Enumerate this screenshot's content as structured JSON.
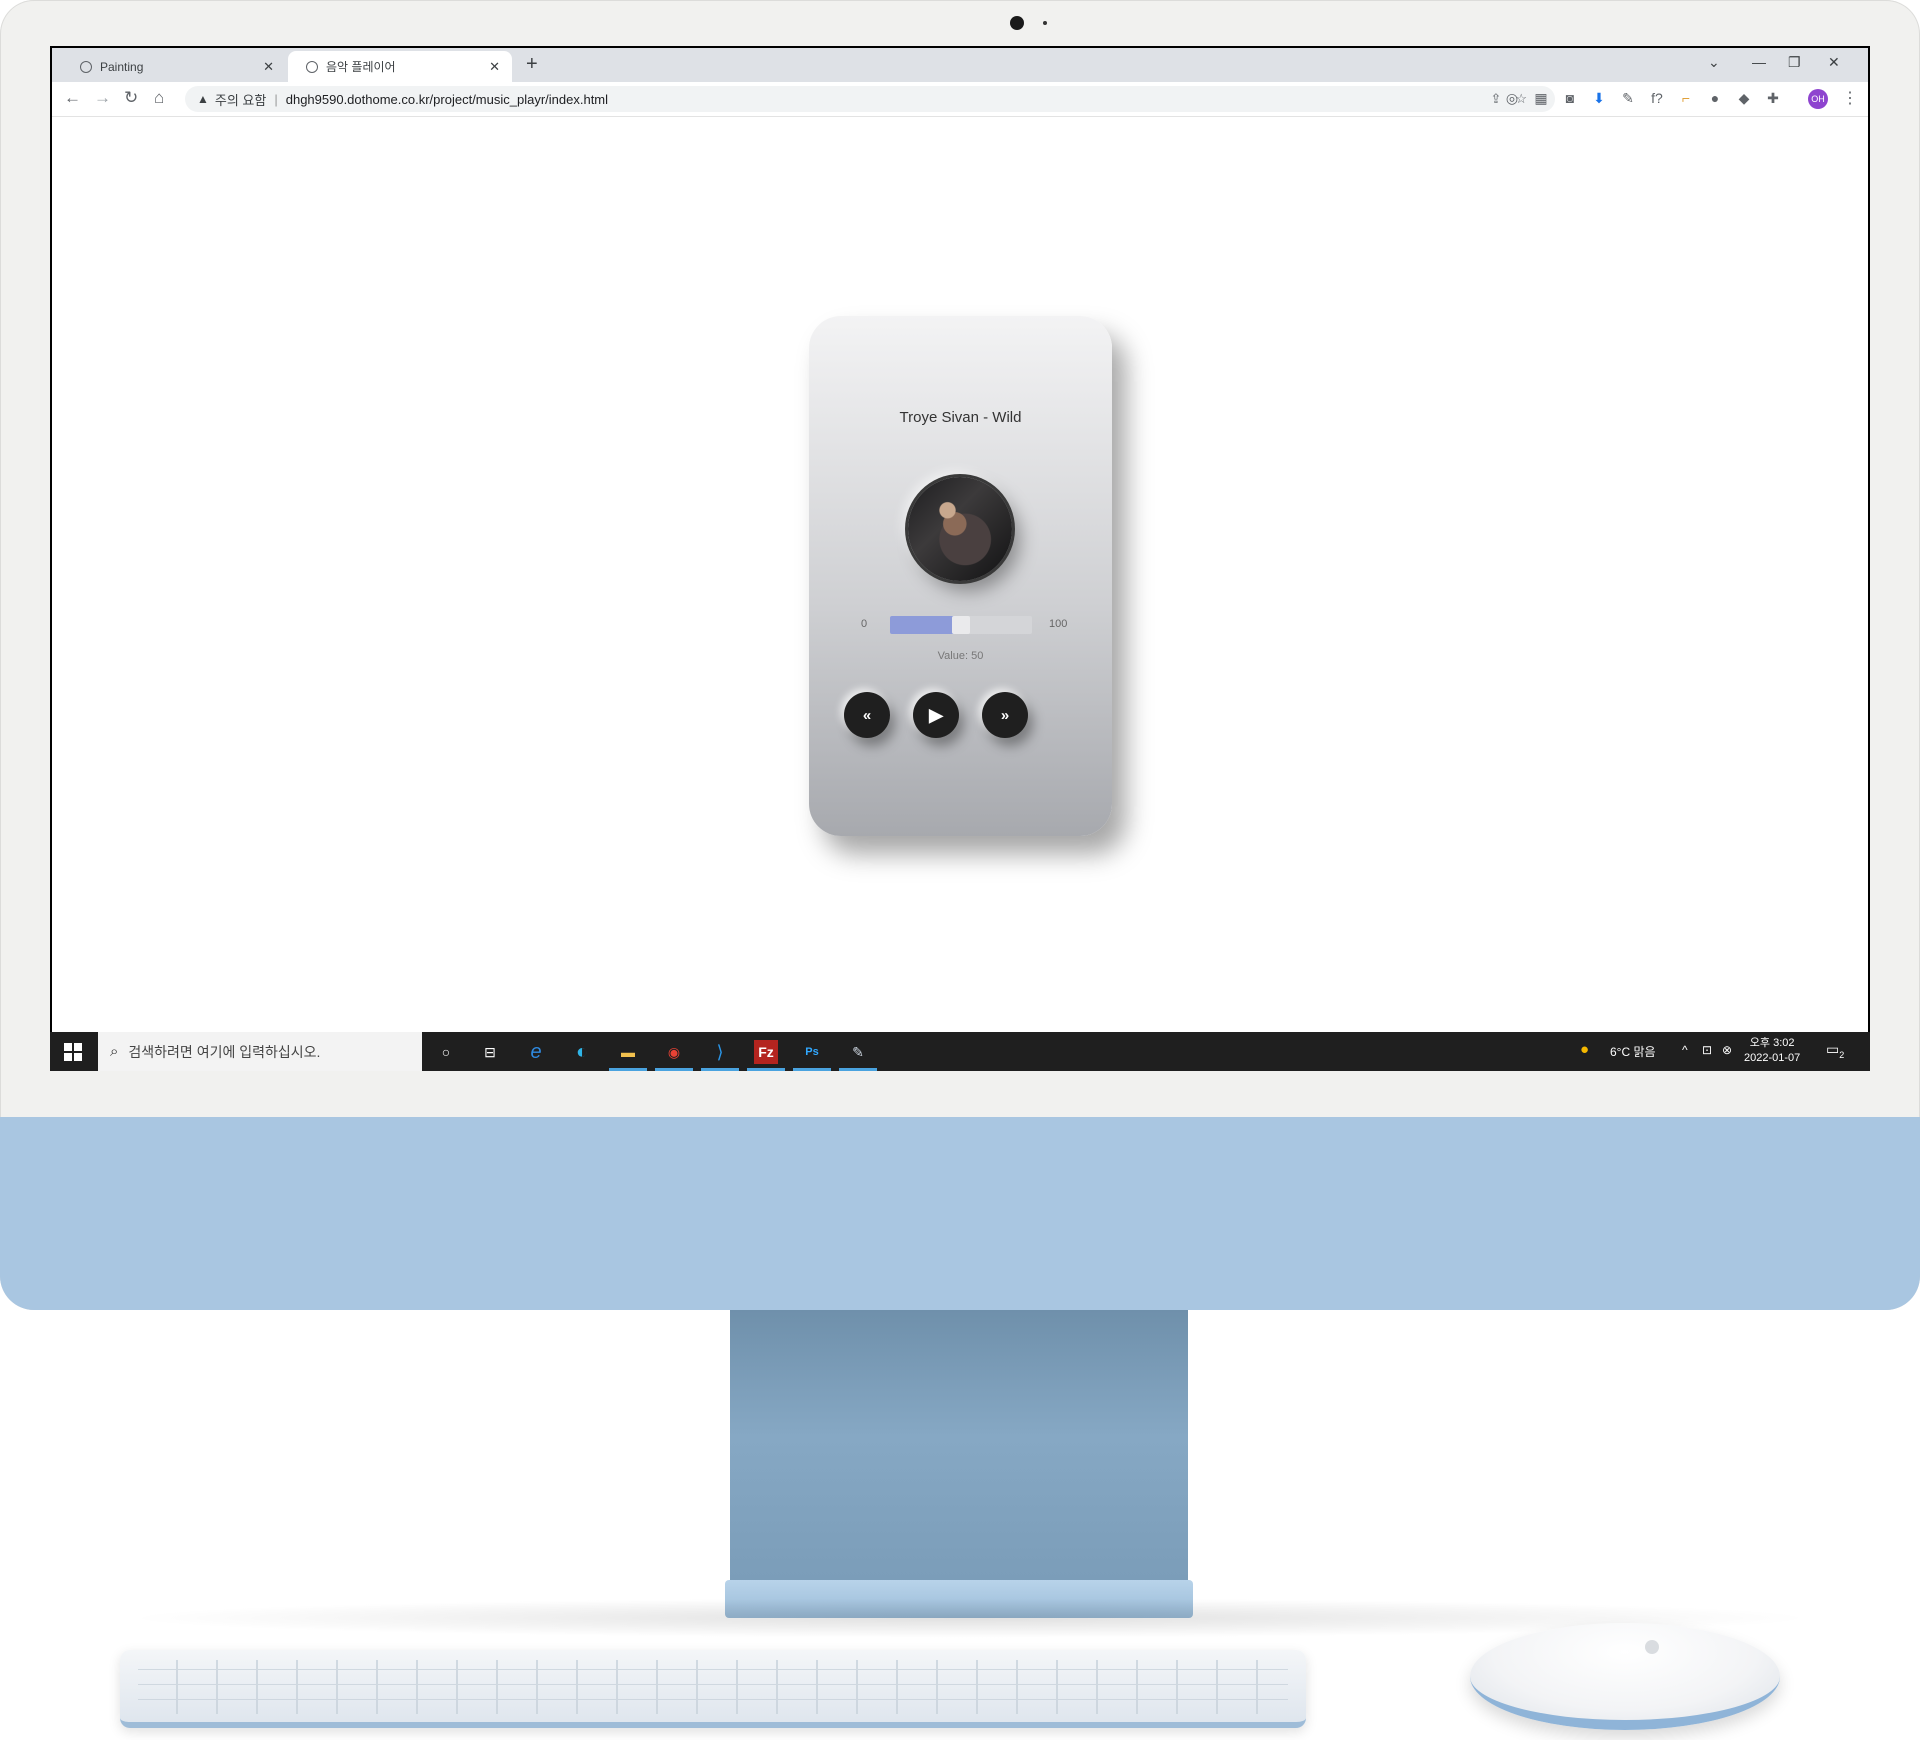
{
  "browser": {
    "tabs": [
      {
        "label": "Painting",
        "active": false
      },
      {
        "label": "음악 플레이어",
        "active": true
      }
    ],
    "new_tab_label": "+",
    "security_warning": "주의 요함",
    "url": "dhgh9590.dothome.co.kr/project/music_playr/index.html",
    "profile_initials": "OH"
  },
  "player": {
    "song_title": "Troye Sivan - Wild",
    "range_min": "0",
    "range_max": "100",
    "value_label": "Value: 50",
    "progress_value": 50,
    "accent_color": "#8d9bd9",
    "controls": [
      "rewind-icon",
      "play-icon",
      "fast-forward-icon"
    ]
  },
  "taskbar": {
    "search_placeholder": "검색하려면 여기에 입력하십시오.",
    "weather": "6°C  맑음",
    "time": "오후 3:02",
    "date": "2022-01-07",
    "notification_count": "2"
  }
}
